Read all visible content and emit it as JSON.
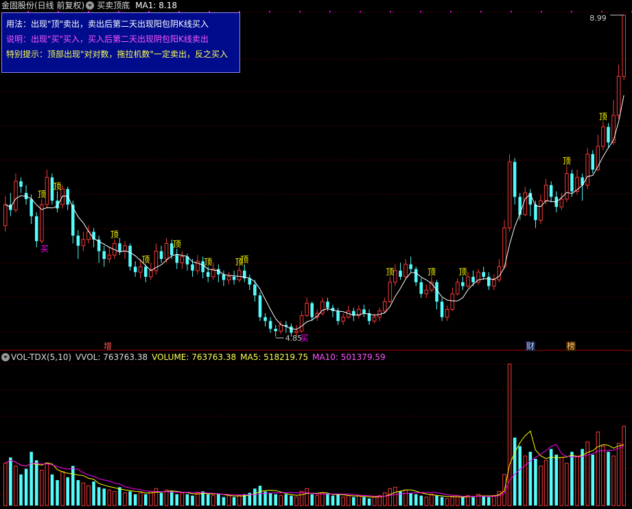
{
  "header": {
    "stock": "金固股份(日线 前复权)",
    "indicator": "买卖顶底",
    "ma_label": "MA1: 8.18"
  },
  "info": {
    "usage": "用法：出现\"顶\"卖出，卖出后第二天出现阳包阴K线买入",
    "desc": "说明：出现\"买\"买入，买入后第二天出现阴包阳K线卖出",
    "tip": "特别提示：顶部出现\"对对数，拖拉机数\"一定卖出，反之买入"
  },
  "price": {
    "high_label": "8.99",
    "low_label": "4.85",
    "ding": "顶",
    "mai": "买"
  },
  "events": {
    "zeng": "增",
    "cai": "财",
    "bang": "榜"
  },
  "volume": {
    "name": "VOL-TDX(5,10)",
    "vvol": "VVOL: 763763.38",
    "volume": "VOLUME: 763763.38",
    "ma5": "MA5: 518219.75",
    "ma10": "MA10: 501379.59"
  },
  "colors": {
    "up": "#ff3a3a",
    "down": "#54fcfc",
    "ma": "#ffffff",
    "ma5": "#ffff00",
    "ma10": "#ff00ff",
    "ding": "#ffff00",
    "mai": "#ff00ff",
    "grid": "#8c0000"
  },
  "chart_data": {
    "type": "candlestick",
    "price_range": [
      4.85,
      8.99
    ],
    "candles": [
      [
        6.28,
        6.55,
        6.66,
        6.2
      ],
      [
        6.55,
        6.48,
        6.7,
        6.4
      ],
      [
        6.48,
        6.85,
        6.95,
        6.45
      ],
      [
        6.85,
        6.78,
        6.9,
        6.7
      ],
      [
        6.7,
        6.62,
        6.8,
        6.55
      ],
      [
        6.62,
        6.4,
        6.68,
        6.3
      ],
      [
        6.4,
        6.08,
        6.45,
        6.0
      ],
      [
        6.08,
        6.55,
        6.62,
        6.05
      ],
      [
        6.55,
        6.9,
        7.0,
        6.5
      ],
      [
        6.9,
        6.6,
        6.95,
        6.55
      ],
      [
        6.6,
        6.5,
        6.72,
        6.45
      ],
      [
        6.55,
        6.75,
        6.8,
        6.5
      ],
      [
        6.75,
        6.55,
        6.78,
        6.48
      ],
      [
        6.55,
        6.15,
        6.6,
        6.05
      ],
      [
        6.15,
        6.02,
        6.22,
        5.85
      ],
      [
        6.02,
        6.1,
        6.2,
        5.95
      ],
      [
        6.1,
        6.2,
        6.28,
        6.05
      ],
      [
        6.2,
        6.1,
        6.25,
        6.0
      ],
      [
        6.1,
        5.95,
        6.15,
        5.8
      ],
      [
        5.95,
        5.85,
        6.02,
        5.75
      ],
      [
        5.85,
        5.9,
        6.0,
        5.8
      ],
      [
        5.9,
        6.05,
        6.1,
        5.85
      ],
      [
        6.05,
        5.95,
        6.12,
        5.9
      ],
      [
        5.95,
        6.02,
        6.08,
        5.85
      ],
      [
        6.02,
        5.75,
        6.05,
        5.7
      ],
      [
        5.75,
        5.68,
        5.82,
        5.62
      ],
      [
        5.68,
        5.75,
        5.85,
        5.6
      ],
      [
        5.75,
        5.62,
        5.78,
        5.55
      ],
      [
        5.62,
        5.7,
        5.8,
        5.58
      ],
      [
        5.7,
        5.95,
        6.05,
        5.65
      ],
      [
        5.95,
        5.85,
        6.02,
        5.8
      ],
      [
        5.85,
        6.05,
        6.12,
        5.8
      ],
      [
        6.05,
        5.9,
        6.1,
        5.85
      ],
      [
        5.9,
        5.8,
        5.98,
        5.72
      ],
      [
        5.8,
        5.88,
        5.95,
        5.72
      ],
      [
        5.88,
        5.78,
        5.92,
        5.7
      ],
      [
        5.78,
        5.7,
        5.85,
        5.62
      ],
      [
        5.7,
        5.82,
        5.9,
        5.65
      ],
      [
        5.82,
        5.68,
        5.88,
        5.6
      ],
      [
        5.68,
        5.62,
        5.75,
        5.55
      ],
      [
        5.62,
        5.72,
        5.8,
        5.58
      ],
      [
        5.72,
        5.65,
        5.78,
        5.55
      ],
      [
        5.65,
        5.58,
        5.7,
        5.5
      ],
      [
        5.58,
        5.62,
        5.68,
        5.52
      ],
      [
        5.62,
        5.58,
        5.7,
        5.52
      ],
      [
        5.58,
        5.7,
        5.75,
        5.55
      ],
      [
        5.7,
        5.6,
        5.78,
        5.55
      ],
      [
        5.6,
        5.52,
        5.65,
        5.45
      ],
      [
        5.52,
        5.38,
        5.58,
        5.3
      ],
      [
        5.38,
        5.1,
        5.42,
        5.05
      ],
      [
        5.1,
        5.05,
        5.15,
        4.98
      ],
      [
        5.05,
        4.95,
        5.1,
        4.9
      ],
      [
        4.95,
        4.92,
        5.0,
        4.85
      ],
      [
        4.92,
        5.0,
        5.05,
        4.88
      ],
      [
        5.0,
        4.98,
        5.05,
        4.9
      ],
      [
        4.98,
        4.9,
        5.02,
        4.85
      ],
      [
        4.9,
        4.92,
        5.0,
        4.86
      ],
      [
        4.92,
        5.12,
        5.18,
        4.9
      ],
      [
        5.12,
        5.28,
        5.35,
        5.1
      ],
      [
        5.28,
        5.1,
        5.3,
        5.05
      ],
      [
        5.1,
        5.15,
        5.2,
        5.05
      ],
      [
        5.15,
        5.3,
        5.35,
        5.12
      ],
      [
        5.3,
        5.22,
        5.35,
        5.18
      ],
      [
        5.22,
        5.18,
        5.26,
        5.1
      ],
      [
        5.18,
        5.05,
        5.22,
        5.0
      ],
      [
        5.05,
        5.1,
        5.15,
        5.0
      ],
      [
        5.1,
        5.18,
        5.25,
        5.08
      ],
      [
        5.18,
        5.12,
        5.22,
        5.05
      ],
      [
        5.12,
        5.2,
        5.25,
        5.08
      ],
      [
        5.2,
        5.15,
        5.26,
        5.1
      ],
      [
        5.15,
        5.05,
        5.2,
        5.0
      ],
      [
        5.05,
        5.1,
        5.15,
        5.02
      ],
      [
        5.1,
        5.18,
        5.22,
        5.05
      ],
      [
        5.18,
        5.3,
        5.35,
        5.15
      ],
      [
        5.3,
        5.55,
        5.62,
        5.28
      ],
      [
        5.55,
        5.7,
        5.78,
        5.5
      ],
      [
        5.7,
        5.62,
        5.8,
        5.58
      ],
      [
        5.62,
        5.78,
        5.85,
        5.6
      ],
      [
        5.78,
        5.72,
        5.88,
        5.68
      ],
      [
        5.72,
        5.55,
        5.75,
        5.5
      ],
      [
        5.55,
        5.4,
        5.6,
        5.35
      ],
      [
        5.4,
        5.45,
        5.52,
        5.35
      ],
      [
        5.45,
        5.55,
        5.62,
        5.42
      ],
      [
        5.55,
        5.3,
        5.58,
        5.2
      ],
      [
        5.3,
        5.1,
        5.35,
        5.05
      ],
      [
        5.1,
        5.2,
        5.25,
        5.05
      ],
      [
        5.2,
        5.4,
        5.48,
        5.18
      ],
      [
        5.4,
        5.55,
        5.6,
        5.38
      ],
      [
        5.55,
        5.5,
        5.62,
        5.45
      ],
      [
        5.5,
        5.62,
        5.68,
        5.48
      ],
      [
        5.62,
        5.55,
        5.7,
        5.5
      ],
      [
        5.55,
        5.68,
        5.72,
        5.52
      ],
      [
        5.68,
        5.62,
        5.75,
        5.58
      ],
      [
        5.62,
        5.5,
        5.68,
        5.45
      ],
      [
        5.5,
        5.58,
        5.65,
        5.45
      ],
      [
        5.58,
        5.75,
        5.85,
        5.55
      ],
      [
        5.75,
        6.25,
        6.35,
        5.72
      ],
      [
        6.25,
        7.1,
        7.2,
        6.2
      ],
      [
        7.1,
        6.65,
        7.15,
        6.55
      ],
      [
        6.65,
        6.42,
        6.7,
        6.35
      ],
      [
        6.42,
        6.7,
        6.78,
        6.4
      ],
      [
        6.7,
        6.55,
        6.75,
        6.4
      ],
      [
        6.55,
        6.35,
        6.6,
        6.25
      ],
      [
        6.35,
        6.6,
        6.68,
        6.3
      ],
      [
        6.6,
        6.8,
        6.88,
        6.55
      ],
      [
        6.8,
        6.65,
        6.85,
        6.58
      ],
      [
        6.65,
        6.52,
        6.72,
        6.45
      ],
      [
        6.52,
        6.62,
        6.7,
        6.48
      ],
      [
        6.62,
        6.95,
        7.05,
        6.58
      ],
      [
        6.95,
        6.72,
        7.0,
        6.65
      ],
      [
        6.72,
        6.9,
        7.0,
        6.68
      ],
      [
        6.9,
        6.8,
        6.95,
        6.6
      ],
      [
        6.8,
        7.2,
        7.28,
        6.75
      ],
      [
        7.2,
        7.0,
        7.25,
        6.95
      ],
      [
        7.0,
        7.3,
        7.45,
        6.98
      ],
      [
        7.3,
        7.55,
        7.62,
        7.25
      ],
      [
        7.55,
        7.35,
        7.6,
        7.28
      ],
      [
        7.35,
        7.7,
        7.9,
        7.32
      ],
      [
        7.7,
        8.2,
        8.35,
        7.65
      ],
      [
        8.2,
        8.99,
        8.99,
        8.15
      ]
    ],
    "volumes": [
      0.3,
      0.34,
      0.28,
      0.22,
      0.26,
      0.38,
      0.32,
      0.25,
      0.3,
      0.22,
      0.18,
      0.24,
      0.2,
      0.28,
      0.18,
      0.16,
      0.14,
      0.17,
      0.13,
      0.12,
      0.11,
      0.1,
      0.13,
      0.09,
      0.1,
      0.08,
      0.09,
      0.08,
      0.1,
      0.12,
      0.09,
      0.11,
      0.1,
      0.08,
      0.09,
      0.08,
      0.07,
      0.09,
      0.1,
      0.08,
      0.07,
      0.08,
      0.06,
      0.07,
      0.06,
      0.07,
      0.08,
      0.09,
      0.12,
      0.14,
      0.1,
      0.09,
      0.08,
      0.07,
      0.08,
      0.07,
      0.06,
      0.1,
      0.12,
      0.08,
      0.07,
      0.09,
      0.08,
      0.07,
      0.08,
      0.06,
      0.07,
      0.06,
      0.07,
      0.06,
      0.05,
      0.06,
      0.07,
      0.09,
      0.12,
      0.13,
      0.1,
      0.11,
      0.09,
      0.08,
      0.07,
      0.06,
      0.08,
      0.07,
      0.06,
      0.05,
      0.06,
      0.07,
      0.06,
      0.07,
      0.06,
      0.08,
      0.07,
      0.06,
      0.07,
      0.1,
      0.22,
      1.0,
      0.48,
      0.42,
      0.35,
      0.38,
      0.33,
      0.28,
      0.32,
      0.4,
      0.36,
      0.34,
      0.3,
      0.38,
      0.35,
      0.4,
      0.45,
      0.36,
      0.52,
      0.42,
      0.38,
      0.35,
      0.44,
      0.56
    ],
    "ding_marks": [
      7,
      10,
      21,
      27,
      33,
      39,
      45,
      46,
      74,
      82,
      88,
      108,
      115,
      121,
      127
    ],
    "mai_marks": [
      7,
      57,
      127,
      132
    ]
  }
}
